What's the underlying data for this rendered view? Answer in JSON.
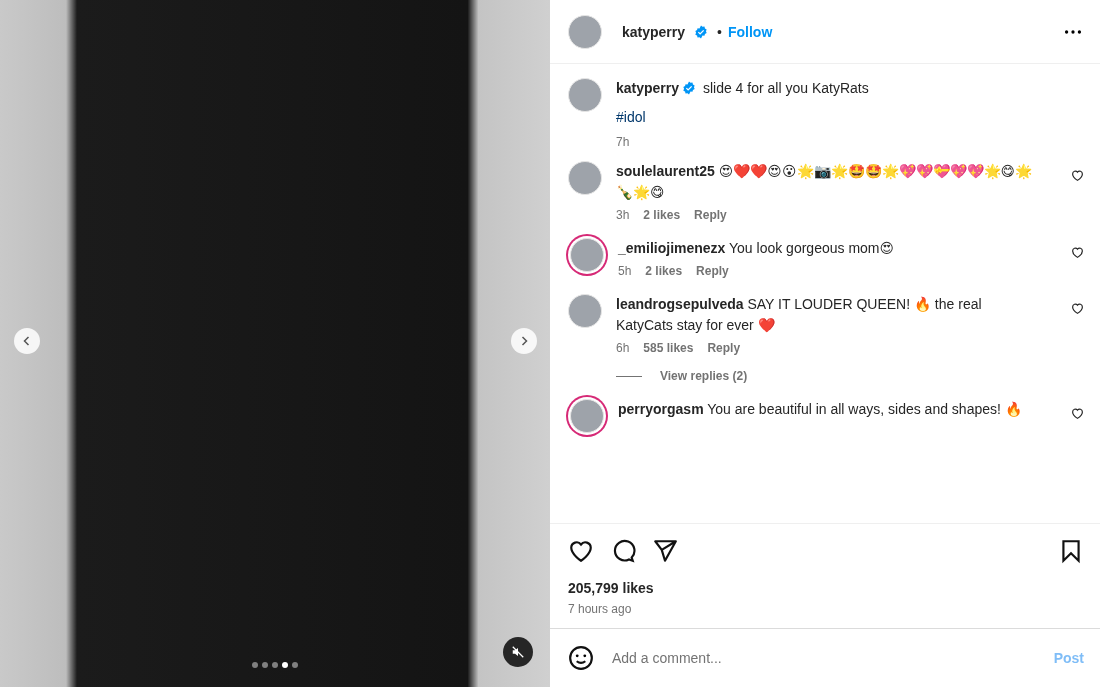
{
  "media": {
    "slides": [
      {
        "selected": false
      },
      {
        "selected": false
      },
      {
        "selected": false
      },
      {
        "selected": true
      },
      {
        "selected": false
      }
    ],
    "muted": true
  },
  "header": {
    "username": "katyperry",
    "verified": true,
    "separator": "•",
    "follow_label": "Follow"
  },
  "caption": {
    "username": "katyperry",
    "verified": true,
    "text": "slide 4 for all you KatyRats",
    "hashtag": "#idol",
    "time": "7h"
  },
  "comments": [
    {
      "username": "soulelaurent25",
      "text": "😍❤️❤️😍😮🌟📷🌟🤩🤩🌟💖💖💝💖💖🌟😋🌟🍾🌟😋",
      "time": "3h",
      "likes": "2 likes",
      "reply_label": "Reply",
      "story_ring": false
    },
    {
      "username": "_emiliojimenezx",
      "text": "You look gorgeous mom😍",
      "time": "5h",
      "likes": "2 likes",
      "reply_label": "Reply",
      "story_ring": true
    },
    {
      "username": "leandrogsepulveda",
      "text": "SAY IT LOUDER QUEEN! 🔥 the real KatyCats stay for ever ❤️",
      "time": "6h",
      "likes": "585 likes",
      "reply_label": "Reply",
      "story_ring": false,
      "view_replies": "View replies (2)"
    },
    {
      "username": "perryorgasm",
      "text": "You are beautiful in all ways, sides and shapes! 🔥",
      "story_ring": true
    }
  ],
  "likes": "205,799 likes",
  "time_ago": "7 hours ago",
  "comment_field": {
    "placeholder": "Add a comment...",
    "post_label": "Post",
    "post_disabled": true
  }
}
